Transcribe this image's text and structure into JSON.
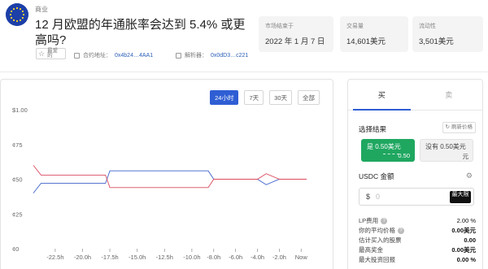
{
  "market": {
    "category": "商业",
    "title": "12 月欧盟的年通胀率会达到 5.4% 或更高吗?",
    "favorite_label": "最爱的",
    "market_address_label": "合约地址：",
    "market_address": "0x4b24…4AA1",
    "resolver_label": "解析器：",
    "resolver_address": "0x0dD3…c221",
    "stats": [
      {
        "key": "市场结束于",
        "value": "2022 年 1 月 7 日"
      },
      {
        "key": "交易量",
        "value": "14,601美元"
      },
      {
        "key": "流动性",
        "value": "3,501美元"
      }
    ]
  },
  "chart": {
    "ranges": [
      "24小时",
      "7天",
      "30天",
      "全部"
    ],
    "active_range": "24小时"
  },
  "chart_data": {
    "type": "line",
    "y_tick_labels": [
      "$1.00",
      "¢75",
      "¢50",
      "¢25",
      "¢0"
    ],
    "ylim": [
      0,
      1
    ],
    "x_tick_labels": [
      "-22.5h",
      "-20.0h",
      "-17.5h",
      "-15.0h",
      "-12.5h",
      "-10.0h",
      "-8.0h",
      "-6.0h",
      "-4.0h",
      "-2.0h",
      "Now"
    ],
    "x": [
      -24.5,
      -23.8,
      -17.9,
      -17.5,
      -17.0,
      -10.0,
      -8.5,
      -8.0,
      -4.0,
      -3.2,
      -2.0,
      0.5
    ],
    "series": [
      {
        "color": "#3f62c9",
        "values": [
          0.4,
          0.47,
          0.47,
          0.56,
          0.56,
          0.56,
          0.56,
          0.5,
          0.5,
          0.46,
          0.5,
          0.5
        ]
      },
      {
        "color": "#d94b5f",
        "values": [
          0.6,
          0.53,
          0.53,
          0.44,
          0.44,
          0.44,
          0.44,
          0.5,
          0.5,
          0.54,
          0.5,
          0.5
        ]
      }
    ],
    "grid": false,
    "legend": "none"
  },
  "trade": {
    "tabs": [
      "买",
      "卖"
    ],
    "active_tab": "买",
    "pick_outcome_label": "选择结果",
    "refresh_label": "刷新价格",
    "outcomes": [
      {
        "name": "是",
        "price": "0.50美元",
        "sub": "0.50"
      },
      {
        "name": "没有",
        "price": "0.50美元",
        "sub": "元"
      }
    ],
    "amount_label": "USDC 金额",
    "currency_symbol": "$",
    "amount_placeholder": "0",
    "max_label": "最大限",
    "info": [
      {
        "key": "LP费用",
        "value": "2.00 %"
      },
      {
        "key": "你的平均价格",
        "value": "0.00美元"
      },
      {
        "key": "估计买入的股票",
        "value": "0.00"
      },
      {
        "key": "最高奖金",
        "value": "0.00美元"
      },
      {
        "key": "最大投资回报",
        "value": "0.00 %"
      }
    ]
  },
  "colors": {
    "accent": "#2f5ed4",
    "yes": "#1fa760",
    "series_yes": "#3f62c9",
    "series_no": "#d94b5f"
  },
  "icons": [
    "eu-flag-icon",
    "star-icon",
    "copy-icon",
    "refresh-icon",
    "gear-icon",
    "help-icon"
  ]
}
